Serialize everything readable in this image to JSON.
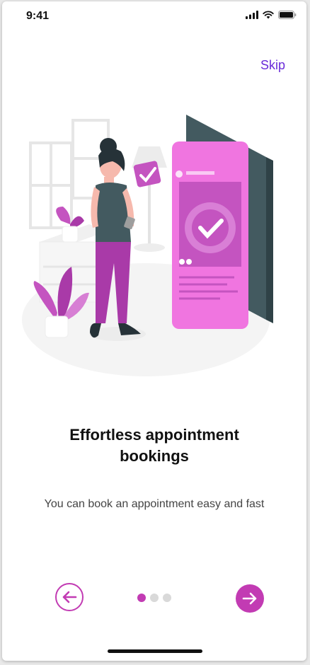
{
  "status_bar": {
    "time": "9:41"
  },
  "header": {
    "skip_label": "Skip"
  },
  "onboarding": {
    "title_line1": "Effortless appointment",
    "title_line2": "bookings",
    "subtitle": "You can book an appointment easy and fast"
  },
  "pagination": {
    "total": 3,
    "active_index": 0
  },
  "colors": {
    "accent": "#c23bb3",
    "skip": "#6a2bd9"
  },
  "icons": {
    "back": "arrow-left-circle-icon",
    "next": "arrow-right-circle-icon"
  }
}
